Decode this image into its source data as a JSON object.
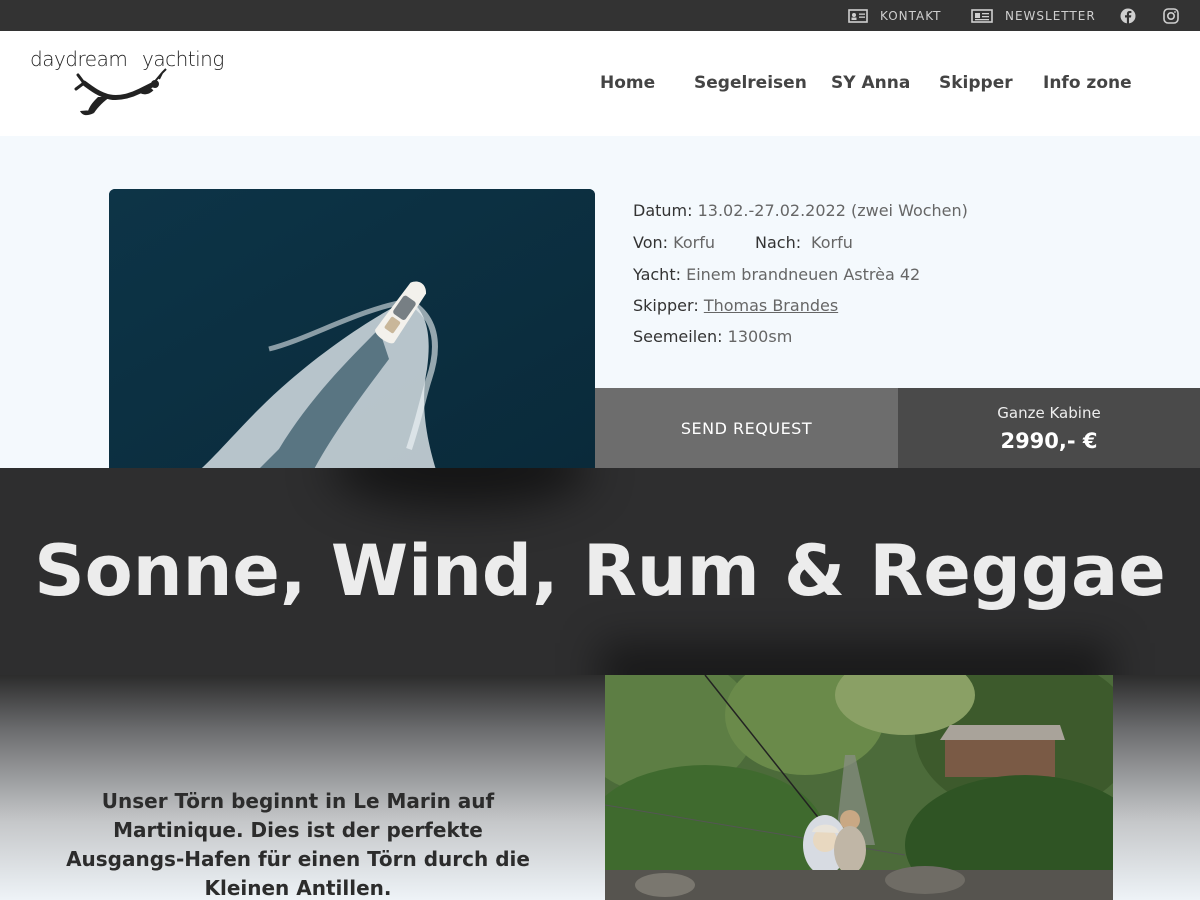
{
  "topbar": {
    "kontakt": "KONTAKT",
    "newsletter": "NEWSLETTER",
    "icons": [
      "contact-card-icon",
      "newspaper-icon",
      "facebook-icon",
      "instagram-icon"
    ]
  },
  "header": {
    "logo_word1": "daydream",
    "logo_word2": "yachting",
    "nav": [
      "Home",
      "Segelreisen",
      "SY Anna",
      "Skipper",
      "Info zone"
    ]
  },
  "details": {
    "datum_label": "Datum:",
    "datum_value": "13.02.-27.02.2022 (zwei Wochen)",
    "von_label": "Von:",
    "von_value": "Korfu",
    "nach_label": "Nach:",
    "nach_value": "Korfu",
    "yacht_label": "Yacht:",
    "yacht_value": "Einem brandneuen Astrèa 42",
    "skipper_label": "Skipper:",
    "skipper_value": "Thomas Brandes",
    "seemeilen_label": "Seemeilen:",
    "seemeilen_value": "1300sm"
  },
  "request": {
    "button_label": "SEND REQUEST",
    "price_label": "Ganze Kabine",
    "price_value": "2990,- €"
  },
  "banner": {
    "title": "Sonne, Wind, Rum & Reggae"
  },
  "intro": {
    "text": "Unser Törn beginnt in Le Marin auf Martinique. Dies ist der perfekte Ausgangs-Hafen für einen Törn durch die Kleinen Antillen."
  },
  "colors": {
    "topbar_bg": "#333333",
    "banner_bg": "#2e2e2f",
    "send_bg": "#6d6d6d",
    "price_bg": "#4a4a4a",
    "page_bg": "#f4f9fd"
  }
}
